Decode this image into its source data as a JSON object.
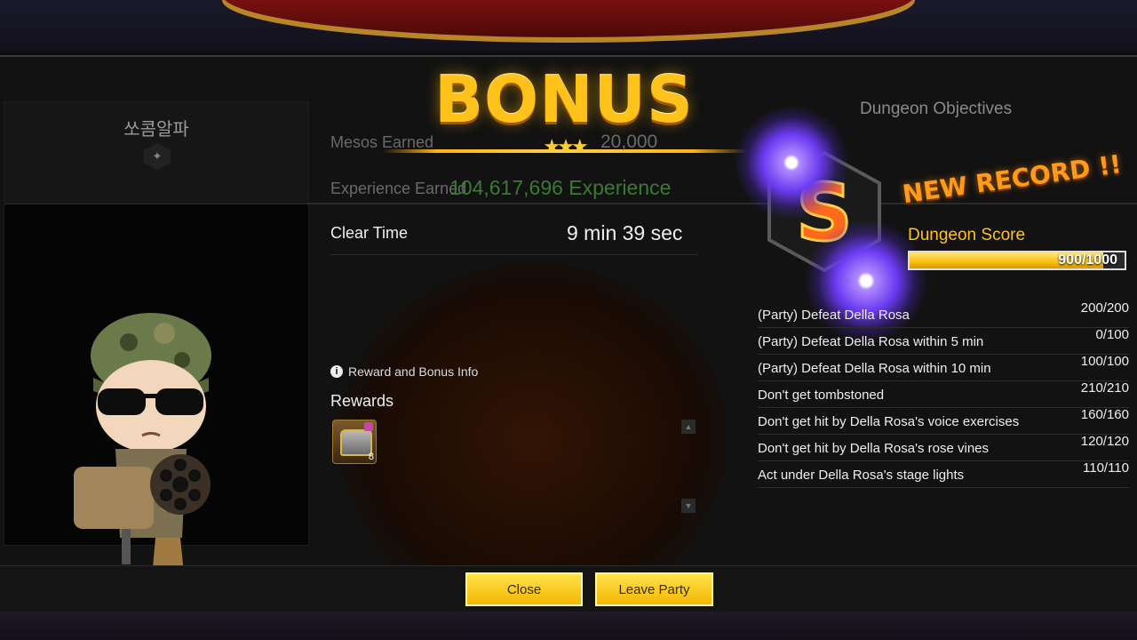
{
  "bonus": {
    "title": "BONUS"
  },
  "character": {
    "name": "쏘콤알파"
  },
  "results": {
    "mesos_label": "Mesos Earned",
    "mesos_value": "20,000",
    "exp_label": "Experience Earned",
    "exp_value": "104,617,696 Experience",
    "clear_time_label": "Clear Time",
    "clear_time_value": "9 min 39 sec"
  },
  "rewards": {
    "info_label": "Reward and Bonus Info",
    "title": "Rewards",
    "items": [
      {
        "icon": "treasure-chest-icon",
        "quantity": "8"
      }
    ]
  },
  "objectives": {
    "title": "Dungeon Objectives",
    "new_record": "NEW RECORD !!",
    "rank": "S",
    "score_label": "Dungeon Score",
    "score_text": "900/1000",
    "score_fraction": 0.9,
    "items": [
      {
        "name": "(Party) Defeat Della Rosa",
        "score": "200/200"
      },
      {
        "name": "(Party) Defeat Della Rosa within 5 min",
        "score": "0/100"
      },
      {
        "name": "(Party) Defeat Della Rosa within 10 min",
        "score": "100/100"
      },
      {
        "name": "Don't get tombstoned",
        "score": "210/210"
      },
      {
        "name": "Don't get hit by Della Rosa's voice exercises",
        "score": "160/160"
      },
      {
        "name": "Don't get hit by Della Rosa's rose vines",
        "score": "120/120"
      },
      {
        "name": "Act under Della Rosa's stage lights",
        "score": "110/110"
      }
    ]
  },
  "buttons": {
    "close": "Close",
    "leave_party": "Leave Party"
  },
  "colors": {
    "accent": "#ffc21a",
    "button": "#f5c400",
    "panel": "#121212"
  }
}
